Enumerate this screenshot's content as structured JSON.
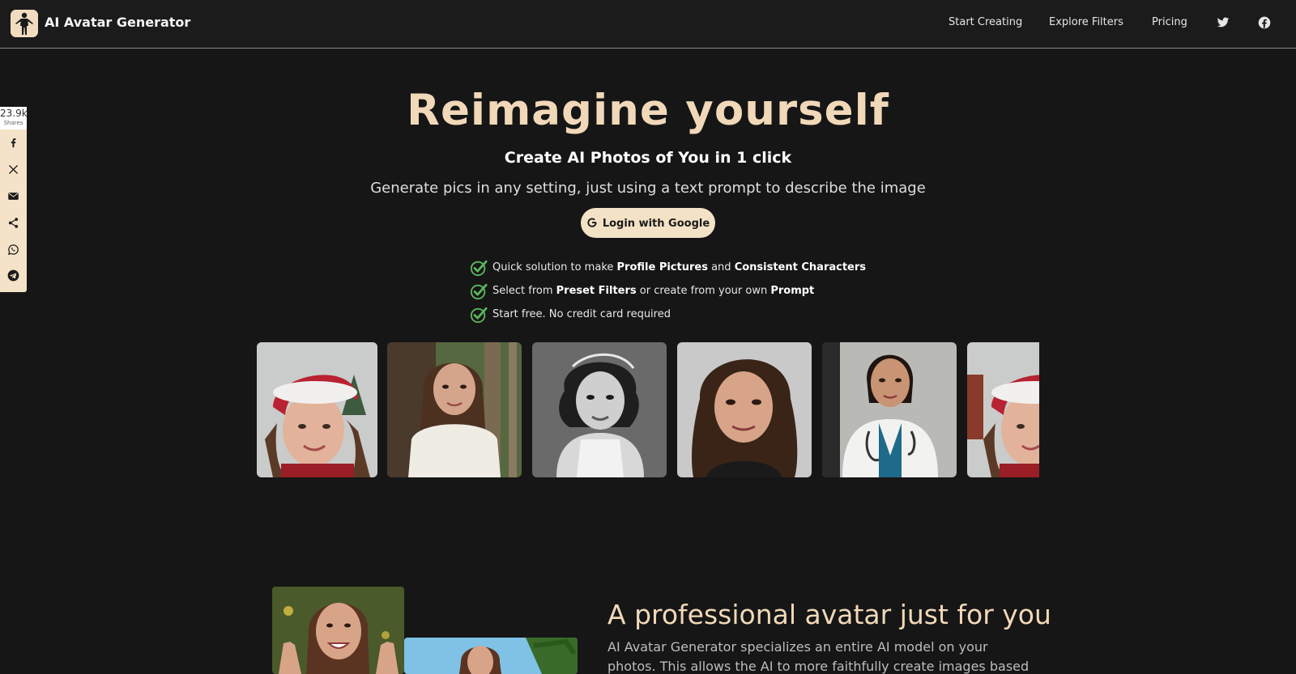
{
  "header": {
    "brand": "AI Avatar Generator",
    "nav": [
      "Start Creating",
      "Explore Filters",
      "Pricing"
    ],
    "icons": [
      "twitter-icon",
      "facebook-icon"
    ]
  },
  "share": {
    "count": "23.9k",
    "count_label": "Shares",
    "buttons": [
      "facebook-icon",
      "x-icon",
      "email-icon",
      "share-icon",
      "whatsapp-icon",
      "telegram-icon"
    ]
  },
  "hero": {
    "title": "Reimagine yourself",
    "subtitle": "Create AI Photos of You in 1 click",
    "description": "Generate pics in any setting, just using a text prompt to describe the image",
    "login_button": "Login with Google"
  },
  "features": [
    [
      {
        "t": "Quick solution to make ",
        "b": false
      },
      {
        "t": "Profile Pictures",
        "b": true
      },
      {
        "t": " and ",
        "b": false
      },
      {
        "t": "Consistent Characters",
        "b": true
      }
    ],
    [
      {
        "t": "Select from ",
        "b": false
      },
      {
        "t": "Preset Filters",
        "b": true
      },
      {
        "t": " or create from your own ",
        "b": false
      },
      {
        "t": "Prompt",
        "b": true
      }
    ],
    [
      {
        "t": "Start free. No credit card required",
        "b": false
      }
    ]
  ],
  "gallery": [
    "christmas-portrait",
    "forest-portrait",
    "vintage-bw-portrait",
    "studio-portrait",
    "doctor-portrait",
    "christmas-portrait"
  ],
  "section": {
    "title": "A professional avatar just for you",
    "text": "AI Avatar Generator specializes an entire AI model on your photos. This allows the AI to more faithfully create images based on your body"
  },
  "colors": {
    "background": "#161616",
    "header": "#1b1b1b",
    "accent": "#f1d8b8",
    "button": "#f4e2c6",
    "check": "#5cb85c"
  }
}
